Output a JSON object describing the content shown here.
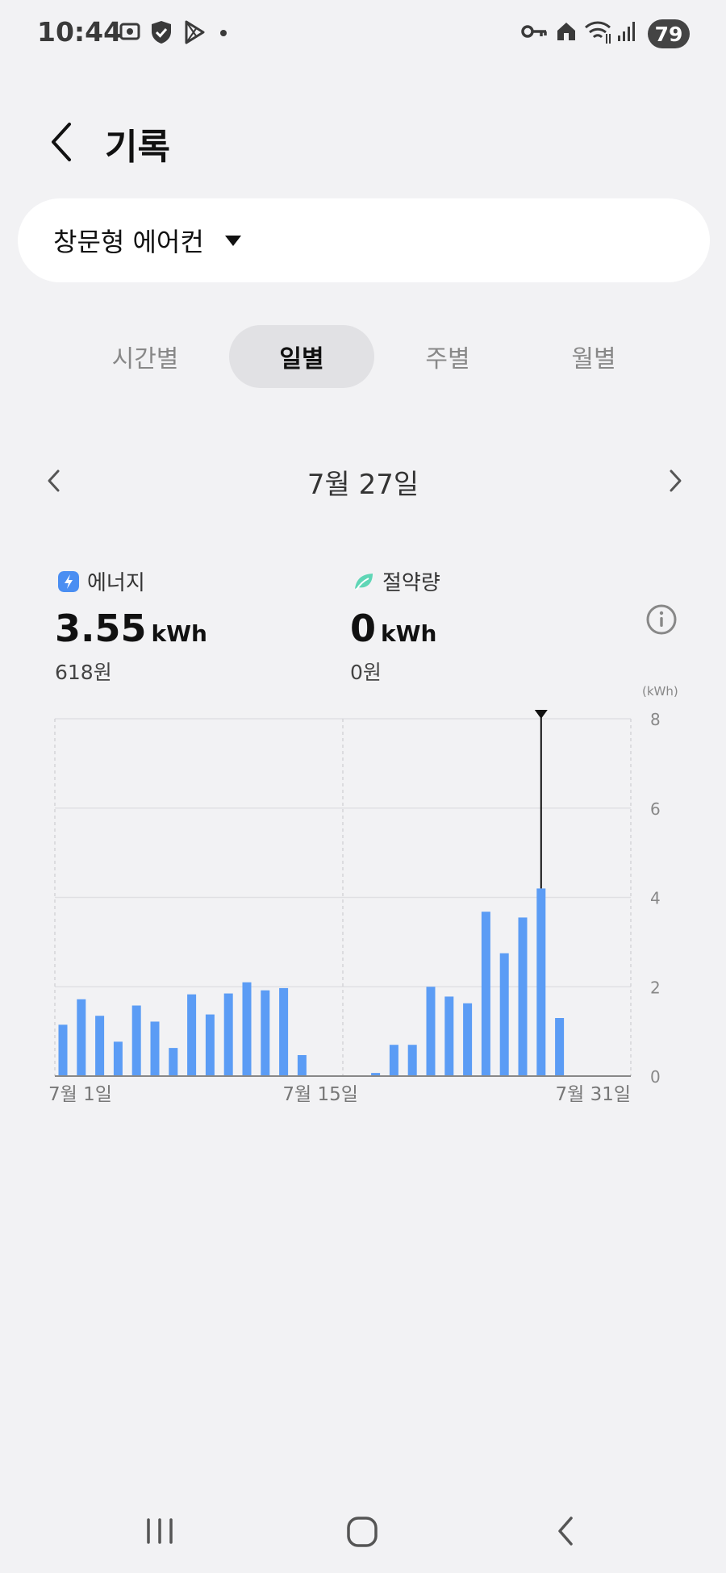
{
  "status_bar": {
    "time": "10:44",
    "battery": "79"
  },
  "header": {
    "title": "기록"
  },
  "device_selector": {
    "name": "창문형 에어컨"
  },
  "tabs": [
    {
      "label": "시간별",
      "active": false
    },
    {
      "label": "일별",
      "active": true
    },
    {
      "label": "주별",
      "active": false
    },
    {
      "label": "월별",
      "active": false
    }
  ],
  "date_nav": {
    "label": "7월 27일"
  },
  "metrics": {
    "energy": {
      "label": "에너지",
      "value": "3.55",
      "unit": "kWh",
      "cost": "618원",
      "color": "#4a8ef2"
    },
    "saving": {
      "label": "절약량",
      "value": "0",
      "unit": "kWh",
      "cost": "0원",
      "color": "#5fd6b6"
    }
  },
  "chart_data": {
    "type": "bar",
    "unit_label": "(kWh)",
    "ylim": [
      0,
      8
    ],
    "yticks": [
      "0",
      "2",
      "4",
      "6",
      "8"
    ],
    "x_labels": [
      {
        "day": 1,
        "text": "7월 1일"
      },
      {
        "day": 15,
        "text": "7월 15일"
      },
      {
        "day": 31,
        "text": "7월 31일"
      }
    ],
    "days": [
      1,
      2,
      3,
      4,
      5,
      6,
      7,
      8,
      9,
      10,
      11,
      12,
      13,
      14,
      15,
      16,
      17,
      18,
      19,
      20,
      21,
      22,
      23,
      24,
      25,
      26,
      27,
      28,
      29,
      30,
      31
    ],
    "values": [
      1.15,
      1.72,
      1.35,
      0.77,
      1.58,
      1.22,
      0.63,
      1.83,
      1.38,
      1.85,
      2.1,
      1.92,
      1.97,
      0.47,
      0,
      0,
      0,
      0.07,
      0.7,
      0.7,
      2.0,
      1.78,
      1.63,
      3.68,
      2.75,
      3.55,
      4.2,
      1.3,
      0,
      0,
      0
    ],
    "selected_day": 27,
    "bar_color": "#5b9cf5",
    "grid": true
  }
}
